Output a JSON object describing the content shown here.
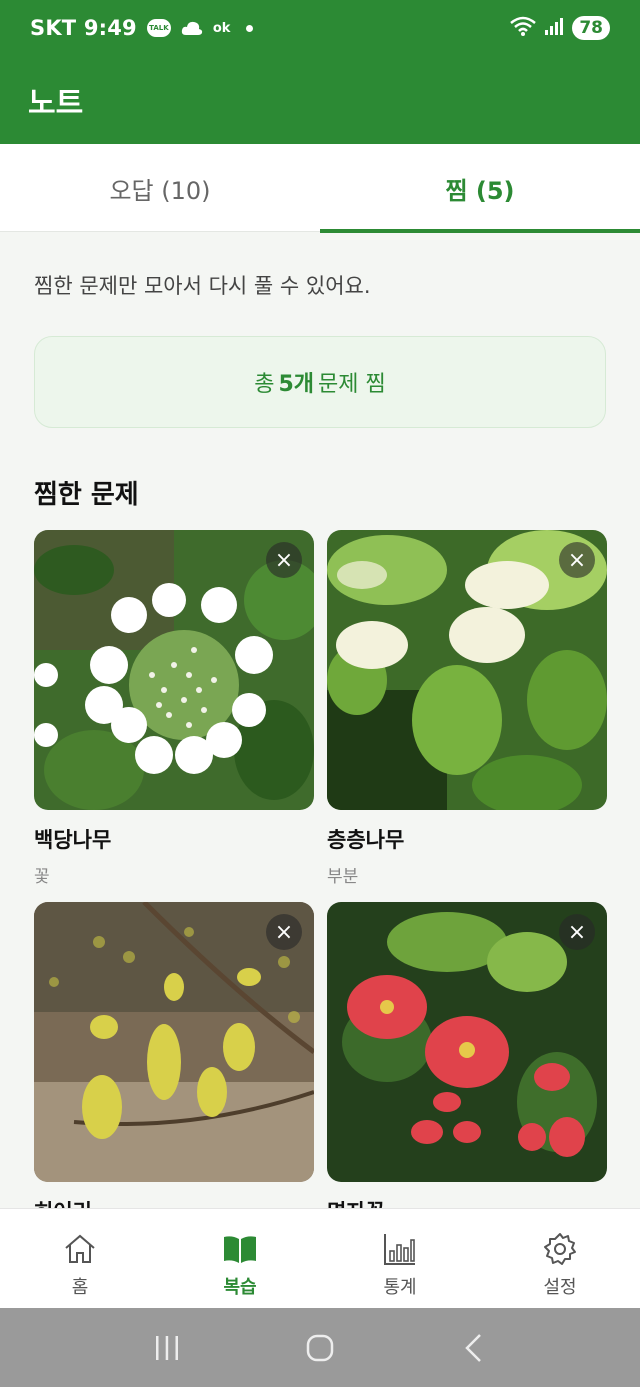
{
  "status_bar": {
    "carrier_time": "SKT 9:49",
    "talk_label": "TALK",
    "ok_label": "ok",
    "battery": "78"
  },
  "app_bar": {
    "title": "노트"
  },
  "tabs": [
    {
      "label": "오답 (10)",
      "active": false
    },
    {
      "label": "찜 (5)",
      "active": true
    }
  ],
  "intro_text": "찜한 문제만 모아서 다시 풀 수 있어요.",
  "summary": {
    "prefix": "총",
    "count": "5개",
    "suffix": "문제 찜"
  },
  "section_title": "찜한 문제",
  "cards": [
    {
      "name": "백당나무",
      "tag": "꽃",
      "image": "white-viburnum-flower"
    },
    {
      "name": "층층나무",
      "tag": "부분",
      "image": "dogwood-white-flower-clusters"
    },
    {
      "name": "히어리",
      "tag": "",
      "image": "yellow-hanging-flowers"
    },
    {
      "name": "명자꽃",
      "tag": "",
      "image": "red-quince-flowers"
    }
  ],
  "close_symbol": "×",
  "bottom_nav": [
    {
      "label": "홈",
      "icon": "home-icon",
      "active": false
    },
    {
      "label": "복습",
      "icon": "book-icon",
      "active": true
    },
    {
      "label": "통계",
      "icon": "chart-icon",
      "active": false
    },
    {
      "label": "설정",
      "icon": "gear-icon",
      "active": false
    }
  ],
  "colors": {
    "brand": "#2c8a34",
    "summary_bg": "#edf6ec",
    "page_bg": "#f4f6f3"
  }
}
